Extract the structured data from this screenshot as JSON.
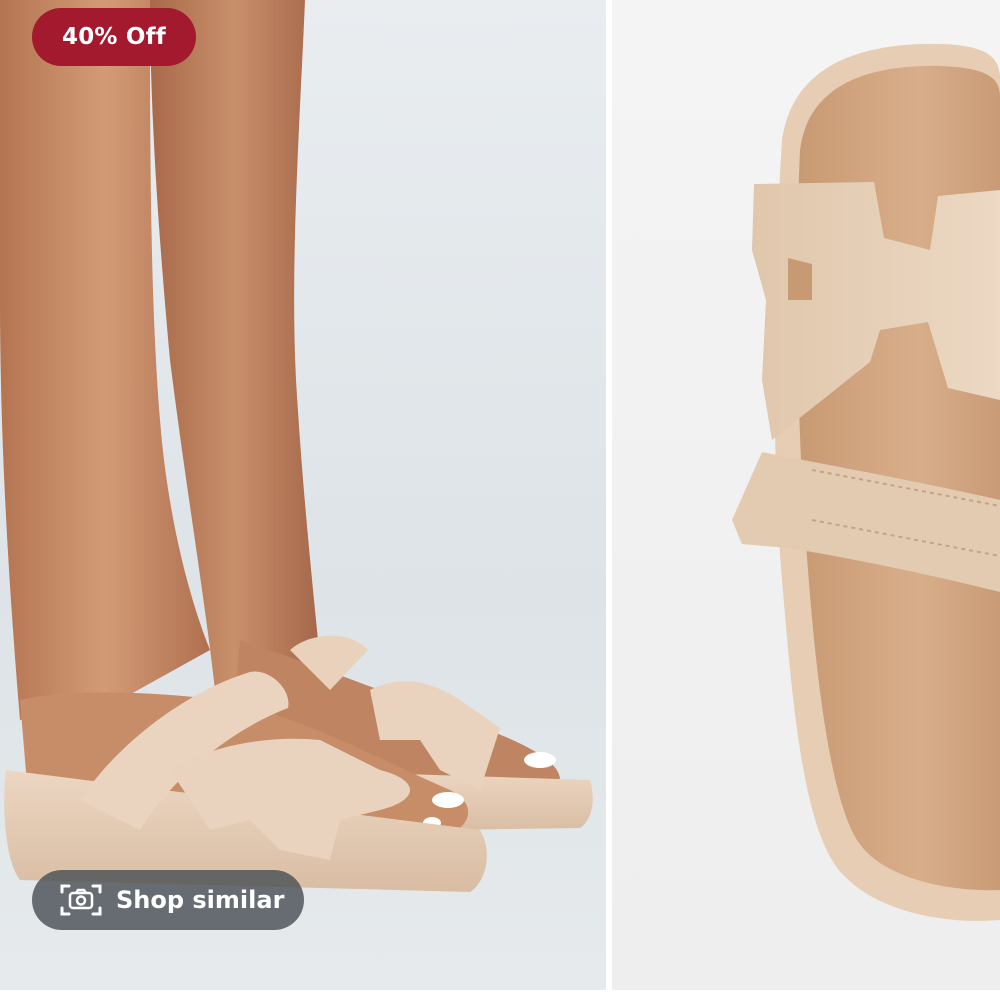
{
  "badge": {
    "text": "40% Off",
    "color": "#a3192d"
  },
  "shop_similar": {
    "label": "Shop similar",
    "icon": "camera-scan-icon"
  },
  "images": [
    {
      "name": "model-wearing-sandals"
    },
    {
      "name": "sandal-close-up"
    }
  ],
  "colors": {
    "sandal": "#e8cfb8",
    "skin": "#c98e68",
    "nail_polish": "#ffffff"
  }
}
